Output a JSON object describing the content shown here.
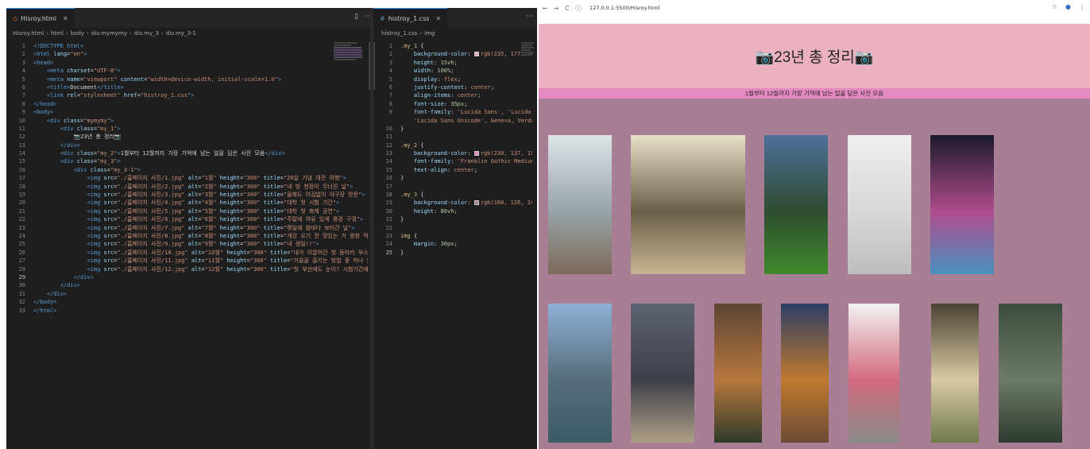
{
  "editor_left": {
    "tab_label": "Hisroy.html",
    "breadcrumb": [
      "Hisroy.html",
      "html",
      "body",
      "div.mymymy",
      "div.my_3",
      "div.my_3-1"
    ],
    "lines": [
      {
        "n": "1",
        "html": "<span class='tag'>&lt;!DOCTYPE html&gt;</span>"
      },
      {
        "n": "2",
        "html": "<span class='tag'>&lt;html</span> <span class='attr'>lang</span>=<span class='str'>\"en\"</span><span class='tag'>&gt;</span>"
      },
      {
        "n": "3",
        "html": "<span class='tag'>&lt;head&gt;</span>"
      },
      {
        "n": "4",
        "html": "    <span class='tag'>&lt;meta</span> <span class='attr'>charset</span>=<span class='str'>\"UTF-8\"</span><span class='tag'>&gt;</span>"
      },
      {
        "n": "5",
        "html": "    <span class='tag'>&lt;meta</span> <span class='attr'>name</span>=<span class='str'>\"viewport\"</span> <span class='attr'>content</span>=<span class='str'>\"width=device-width, initial-scale=1.0\"</span><span class='tag'>&gt;</span>"
      },
      {
        "n": "6",
        "html": "    <span class='tag'>&lt;title&gt;</span><span class='txt'>Document</span><span class='tag'>&lt;/title&gt;</span>"
      },
      {
        "n": "7",
        "html": "    <span class='tag'>&lt;link</span> <span class='attr'>rel</span>=<span class='str'>\"stylesheet\"</span> <span class='attr'>href</span>=<span class='str'>\"histroy_1.css\"</span><span class='tag'>&gt;</span>"
      },
      {
        "n": "8",
        "html": "<span class='tag'>&lt;/head&gt;</span>"
      },
      {
        "n": "9",
        "html": "<span class='tag'>&lt;body&gt;</span>"
      },
      {
        "n": "10",
        "html": "    <span class='tag'>&lt;div</span> <span class='attr'>class</span>=<span class='str'>\"mymymy\"</span><span class='tag'>&gt;</span>"
      },
      {
        "n": "11",
        "html": "        <span class='tag'>&lt;div</span> <span class='attr'>class</span>=<span class='str'>\"my_1\"</span><span class='tag'>&gt;</span>"
      },
      {
        "n": "12",
        "html": "            <span class='txt'>📷23년 총 정리📷</span>"
      },
      {
        "n": "13",
        "html": "        <span class='tag'>&lt;/div&gt;</span>"
      },
      {
        "n": "14",
        "html": "        <span class='tag'>&lt;div</span> <span class='attr'>class</span>=<span class='str'>\"my_2\"</span><span class='tag'>&gt;</span><span class='txt'>1월부터 12월까지 가장 기억에 남는 일을 담은 사진 모음</span><span class='tag'>&lt;/div&gt;</span>"
      },
      {
        "n": "15",
        "html": "        <span class='tag'>&lt;div</span> <span class='attr'>class</span>=<span class='str'>\"my_3\"</span><span class='tag'>&gt;</span>"
      },
      {
        "n": "16",
        "html": "            <span class='tag'>&lt;div</span> <span class='attr'>class</span>=<span class='str'>\"my_3-1\"</span><span class='tag'>&gt;</span>"
      },
      {
        "n": "17",
        "html": "                <span class='tag'>&lt;img</span> <span class='attr'>src</span>=<span class='str'>\"./홈페이지 사진/1.jpg\"</span> <span class='attr'>alt</span>=<span class='str'>\"1월\"</span> <span class='attr'>height</span>=<span class='str'>\"300\"</span> <span class='attr'>title</span>=<span class='str'>\"20살 기념 대전 여행\"</span><span class='tag'>&gt;</span>"
      },
      {
        "n": "18",
        "html": "                <span class='tag'>&lt;img</span> <span class='attr'>src</span>=<span class='str'>\"./홈페이지 사진/2.jpg\"</span> <span class='attr'>alt</span>=<span class='str'>\"2월\"</span> <span class='attr'>height</span>=<span class='str'>\"300\"</span> <span class='attr'>title</span>=<span class='str'>\"내 방 천장이 무너진 날\"</span><span class='tag'>&gt;</span>"
      },
      {
        "n": "19",
        "html": "                <span class='tag'>&lt;img</span> <span class='attr'>src</span>=<span class='str'>\"./홈페이지 사진/3.jpg\"</span> <span class='attr'>alt</span>=<span class='str'>\"3월\"</span> <span class='attr'>height</span>=<span class='str'>\"300\"</span> <span class='attr'>title</span>=<span class='str'>\"올해도 어김없이 야구장 방문\"</span><span class='tag'>&gt;</span>"
      },
      {
        "n": "20",
        "html": "                <span class='tag'>&lt;img</span> <span class='attr'>src</span>=<span class='str'>\"./홈페이지 사진/4.jpg\"</span> <span class='attr'>alt</span>=<span class='str'>\"4월\"</span> <span class='attr'>height</span>=<span class='str'>\"300\"</span> <span class='attr'>title</span>=<span class='str'>\"대학 첫 시험 기간\"</span><span class='tag'>&gt;</span>"
      },
      {
        "n": "21",
        "html": "                <span class='tag'>&lt;img</span> <span class='attr'>src</span>=<span class='str'>\"./홈페이지 사진/5.jpg\"</span> <span class='attr'>alt</span>=<span class='str'>\"5월\"</span> <span class='attr'>height</span>=<span class='str'>\"300\"</span> <span class='attr'>title</span>=<span class='str'>\"대학 첫 축제 공연\"</span><span class='tag'>&gt;</span>"
      },
      {
        "n": "22",
        "html": "                <span class='tag'>&lt;img</span> <span class='attr'>src</span>=<span class='str'>\"./홈페이지 사진/6.jpg\"</span> <span class='attr'>alt</span>=<span class='str'>\"6월\"</span> <span class='attr'>height</span>=<span class='str'>\"300\"</span> <span class='attr'>title</span>=<span class='str'>\"주말에 여유 있게 풍경 구경\"</span><span class='tag'>&gt;</span>"
      },
      {
        "n": "23",
        "html": "                <span class='tag'>&lt;img</span> <span class='attr'>src</span>=<span class='str'>\"./홈페이지 사진/7.jpg\"</span> <span class='attr'>alt</span>=<span class='str'>\"7월\"</span> <span class='attr'>height</span>=<span class='str'>\"300\"</span> <span class='attr'>title</span>=<span class='str'>\"평일에 밤바다 보러간 날\"</span><span class='tag'>&gt;</span>"
      },
      {
        "n": "24",
        "html": "                <span class='tag'>&lt;img</span> <span class='attr'>src</span>=<span class='str'>\"./홈페이지 사진/8.jpg\"</span> <span class='attr'>alt</span>=<span class='str'>\"8월\"</span> <span class='attr'>height</span>=<span class='str'>\"300\"</span> <span class='attr'>title</span>=<span class='str'>\"개강 오기 전 맛있는 거 왕창 먹은 날\"</span><span class='tag'>&gt;</span>"
      },
      {
        "n": "25",
        "html": "                <span class='tag'>&lt;img</span> <span class='attr'>src</span>=<span class='str'>\"./홈페이지 사진/9.jpg\"</span> <span class='attr'>alt</span>=<span class='str'>\"9월\"</span> <span class='attr'>height</span>=<span class='str'>\"300\"</span> <span class='attr'>title</span>=<span class='str'>\"내 생일!!\"</span><span class='tag'>&gt;</span>"
      },
      {
        "n": "26",
        "html": "                <span class='tag'>&lt;img</span> <span class='attr'>src</span>=<span class='str'>\"./홈페이지 사진/10.jpg\"</span> <span class='attr'>alt</span>=<span class='str'>\"10월\"</span> <span class='attr'>height</span>=<span class='str'>\"300\"</span> <span class='attr'>title</span>=<span class='str'>\"내가 이끌어간 첫 동아리 부스\"</span><span class='tag'>&gt;</span>"
      },
      {
        "n": "27",
        "html": "                <span class='tag'>&lt;img</span> <span class='attr'>src</span>=<span class='str'>\"./홈페이지 사진/11.jpg\"</span> <span class='attr'>alt</span>=<span class='str'>\"11월\"</span> <span class='attr'>height</span>=<span class='str'>\"300\"</span> <span class='attr'>title</span>=<span class='str'>\"가을을 즐기는 방법 중 하나 분룡하 가기\"</span><span class='tag'>&gt;</span>"
      },
      {
        "n": "28",
        "html": "                <span class='tag'>&lt;img</span> <span class='attr'>src</span>=<span class='str'>\"./홈페이지 사진/12.jpg\"</span> <span class='attr'>alt</span>=<span class='str'>\"12월\"</span> <span class='attr'>height</span>=<span class='str'>\"300\"</span> <span class='attr'>title</span>=<span class='str'>\"첫 부산에도 눈이? 시험기간에 학교에서 눈을 보다\"</span><span class='tag'>&gt;</span>"
      },
      {
        "n": "29",
        "html": "            <span class='tag'>&lt;/div&gt;</span>",
        "active": true
      },
      {
        "n": "30",
        "html": "        <span class='tag'>&lt;/div&gt;</span>"
      },
      {
        "n": "31",
        "html": "    <span class='tag'>&lt;/div&gt;</span>"
      },
      {
        "n": "32",
        "html": "<span class='tag'>&lt;/body&gt;</span>"
      },
      {
        "n": "33",
        "html": "<span class='tag'>&lt;/html&gt;</span>"
      }
    ]
  },
  "editor_right": {
    "tab_label": "histroy_1.css",
    "breadcrumb": [
      "histroy_1.css",
      "img"
    ],
    "lines": [
      {
        "n": "1",
        "html": "<span class='sel'>.my_1</span> <span class='txt'>{</span>"
      },
      {
        "n": "2",
        "html": "    <span class='prop'>background-color</span>: <span class='swatch' style='background:#ebb1c1'></span><span class='val'>rgb(235, 177, 193)</span>;"
      },
      {
        "n": "3",
        "html": "    <span class='prop'>height</span>: <span class='num'>15vh</span>;"
      },
      {
        "n": "4",
        "html": "    <span class='prop'>width</span>: <span class='num'>100%</span>;"
      },
      {
        "n": "5",
        "html": "    <span class='prop'>display</span>: <span class='val'>flex</span>;"
      },
      {
        "n": "6",
        "html": "    <span class='prop'>justify-content</span>: <span class='val'>center</span>;"
      },
      {
        "n": "7",
        "html": "    <span class='prop'>align-items</span>: <span class='val'>center</span>;"
      },
      {
        "n": "8",
        "html": "    <span class='prop'>font-size</span>: <span class='num'>35px</span>;"
      },
      {
        "n": "9",
        "html": "    <span class='prop'>font-family</span>: <span class='val'>'Lucida Sans', 'Lucida Sans Regula</span>"
      },
      {
        "n": "",
        "html": "    <span class='val'>'Lucida Sans Unicode', Geneva, Verdana, sans-se</span>"
      },
      {
        "n": "10",
        "html": "<span class='txt'>}</span>"
      },
      {
        "n": "11",
        "html": ""
      },
      {
        "n": "12",
        "html": "<span class='sel'>.my_2</span> <span class='txt'>{</span>"
      },
      {
        "n": "13",
        "html": "    <span class='prop'>background-color</span>: <span class='swatch' style='background:#e689c2'></span><span class='val'>rgb(230, 137, 194)</span>;"
      },
      {
        "n": "14",
        "html": "    <span class='prop'>font-family</span>: <span class='val'>'Franklin Gothic Medium', 'Arial N</span>"
      },
      {
        "n": "15",
        "html": "    <span class='prop'>text-align</span>: <span class='val'>center</span>;"
      },
      {
        "n": "16",
        "html": "<span class='txt'>}</span>"
      },
      {
        "n": "17",
        "html": ""
      },
      {
        "n": "18",
        "html": "<span class='sel'>.my_3</span> <span class='txt'>{</span>"
      },
      {
        "n": "19",
        "html": "    <span class='prop'>background-color</span>: <span class='swatch' style='background:#a87e95'></span><span class='val'>rgb(168, 126, 149)</span>;"
      },
      {
        "n": "20",
        "html": "    <span class='prop'>height</span>: <span class='num'>80vh</span>;"
      },
      {
        "n": "21",
        "html": "<span class='txt'>}</span>"
      },
      {
        "n": "22",
        "html": ""
      },
      {
        "n": "23",
        "html": "<span class='sel'>img</span> <span class='txt'>{</span>"
      },
      {
        "n": "24",
        "html": "    <span class='prop'>margin</span>: <span class='num'>30px</span>;"
      },
      {
        "n": "25",
        "html": "<span class='txt'>}</span>",
        "active": true
      }
    ]
  },
  "browser": {
    "url": "127.0.0.1:5500/Hisroy.html",
    "back_icon": "←",
    "forward_icon": "→",
    "reload_icon": "C",
    "title_text": "📷23년 총 정리📷",
    "subtitle_text": "1월부터 12월까지 가장 기억에 남는 일을 담은 사진 모음"
  },
  "photos": [
    {
      "alt": "1월",
      "colors": [
        "#dfe4e6",
        "#98a3a8",
        "#7b6a57"
      ]
    },
    {
      "alt": "2월",
      "colors": [
        "#e8e0c8",
        "#6b5f49",
        "#c6b492"
      ]
    },
    {
      "alt": "3월",
      "colors": [
        "#4d6f9a",
        "#2f4c30",
        "#3d8b2b"
      ]
    },
    {
      "alt": "4월",
      "colors": [
        "#eeeeee",
        "#d8d8d8",
        "#bdbdbd"
      ]
    },
    {
      "alt": "5월",
      "colors": [
        "#1a1a2a",
        "#b04c8d",
        "#4a90c0"
      ]
    },
    {
      "alt": "6월",
      "colors": [
        "#8fb0d6",
        "#556e7b",
        "#3b5b66"
      ]
    },
    {
      "alt": "7월",
      "colors": [
        "#5e6270",
        "#3e3f49",
        "#ad9f86"
      ]
    },
    {
      "alt": "8월",
      "colors": [
        "#5d4534",
        "#b7773e",
        "#2f3b2a"
      ]
    },
    {
      "alt": "9월",
      "colors": [
        "#2c3d66",
        "#c07a2f",
        "#6b4a33"
      ]
    },
    {
      "alt": "10월",
      "colors": [
        "#f2f2f2",
        "#d26a80",
        "#8a8a8a"
      ]
    },
    {
      "alt": "11월",
      "colors": [
        "#4a4232",
        "#d9c9a4",
        "#6f7a4a"
      ]
    },
    {
      "alt": "12월",
      "colors": [
        "#3c4c3e",
        "#6e7a68",
        "#2f3a30"
      ]
    }
  ]
}
